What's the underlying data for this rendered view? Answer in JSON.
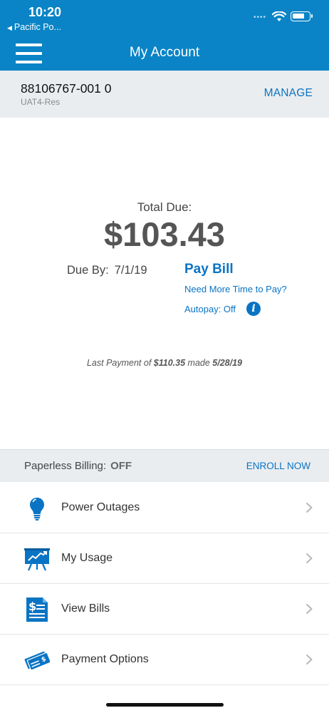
{
  "status_bar": {
    "time": "10:20",
    "back_app": "Pacific Po..."
  },
  "nav": {
    "title": "My Account"
  },
  "account": {
    "number": "88106767-001 0",
    "type": "UAT4-Res",
    "manage_label": "MANAGE"
  },
  "billing": {
    "total_label": "Total Due:",
    "total_amount": "$103.43",
    "due_by_label": "Due By:",
    "due_date": "7/1/19",
    "pay_bill_label": "Pay Bill",
    "more_time_label": "Need More Time to Pay?",
    "autopay_label": "Autopay: Off",
    "info_icon": "i"
  },
  "last_payment": {
    "prefix": "Last Payment of",
    "amount": "$110.35",
    "middle": "made",
    "date": "5/28/19"
  },
  "paperless": {
    "label": "Paperless Billing:",
    "status": "OFF",
    "enroll_label": "ENROLL NOW"
  },
  "menu": {
    "items": [
      {
        "label": "Power Outages",
        "icon": "lightbulb-icon"
      },
      {
        "label": "My Usage",
        "icon": "usage-chart-icon"
      },
      {
        "label": "View Bills",
        "icon": "bill-document-icon"
      },
      {
        "label": "Payment Options",
        "icon": "payment-check-icon"
      }
    ]
  },
  "colors": {
    "brand_blue": "#0a84c6",
    "link_blue": "#0a74c4",
    "band_gray": "#eaedf0"
  }
}
